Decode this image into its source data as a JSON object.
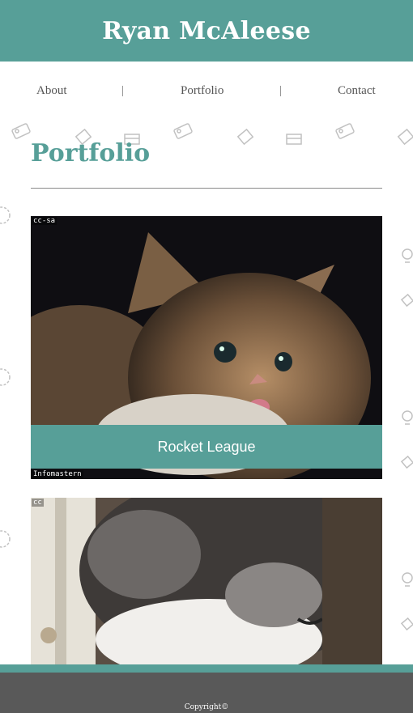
{
  "header": {
    "title": "Ryan McAleese"
  },
  "nav": {
    "items": [
      {
        "label": "About"
      },
      {
        "label": "Portfolio"
      },
      {
        "label": "Contact"
      }
    ],
    "separator": "|"
  },
  "main": {
    "heading": "Portfolio",
    "projects": [
      {
        "caption": "Rocket League",
        "image_tag_top": "cc-sa",
        "image_tag_bottom": "Infomastern"
      },
      {
        "caption": "",
        "image_tag_top": "cc"
      }
    ]
  },
  "footer": {
    "copyright": "Copyright©"
  },
  "colors": {
    "accent": "#579f98",
    "footer": "#595959"
  }
}
